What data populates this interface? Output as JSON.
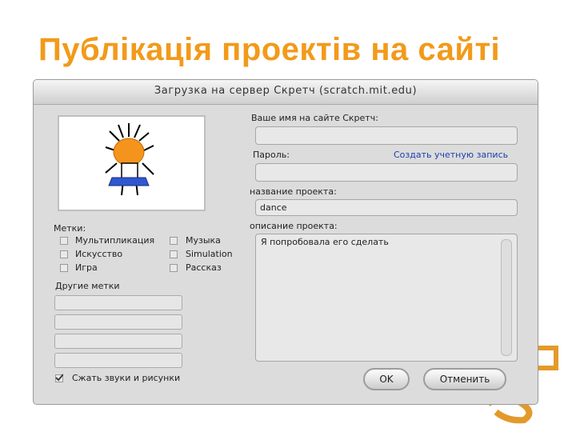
{
  "slide": {
    "title": "Публікація проектів на сайті"
  },
  "dialog": {
    "title": "Загрузка на сервер Скретч (scratch.mit.edu)",
    "username_label": "Ваше имя на сайте Скретч:",
    "username_value": "",
    "password_label": "Пароль:",
    "create_account_link": "Создать учетную запись",
    "password_value": "",
    "project_name_label": "название проекта:",
    "project_name_value": "dance",
    "project_desc_label": "описание проекта:",
    "project_desc_value": "Я попробовала его сделать",
    "tags_label": "Метки:",
    "tags": [
      {
        "label": "Мультипликация",
        "checked": false
      },
      {
        "label": "Музыка",
        "checked": false
      },
      {
        "label": "Искусство",
        "checked": false
      },
      {
        "label": "Simulation",
        "checked": false
      },
      {
        "label": "Игра",
        "checked": false
      },
      {
        "label": "Рассказ",
        "checked": false
      }
    ],
    "other_tags_label": "Другие метки",
    "compress_label": "Сжать звуки и рисунки",
    "compress_checked": true,
    "ok_label": "OK",
    "cancel_label": "Отменить"
  },
  "colors": {
    "title": "#f29a1a",
    "link": "#1a3fb0",
    "dialog_bg": "#dcdcdc"
  },
  "icons": [
    "sprite-thumbnail",
    "checkbox",
    "check-icon",
    "decor-glyph"
  ]
}
